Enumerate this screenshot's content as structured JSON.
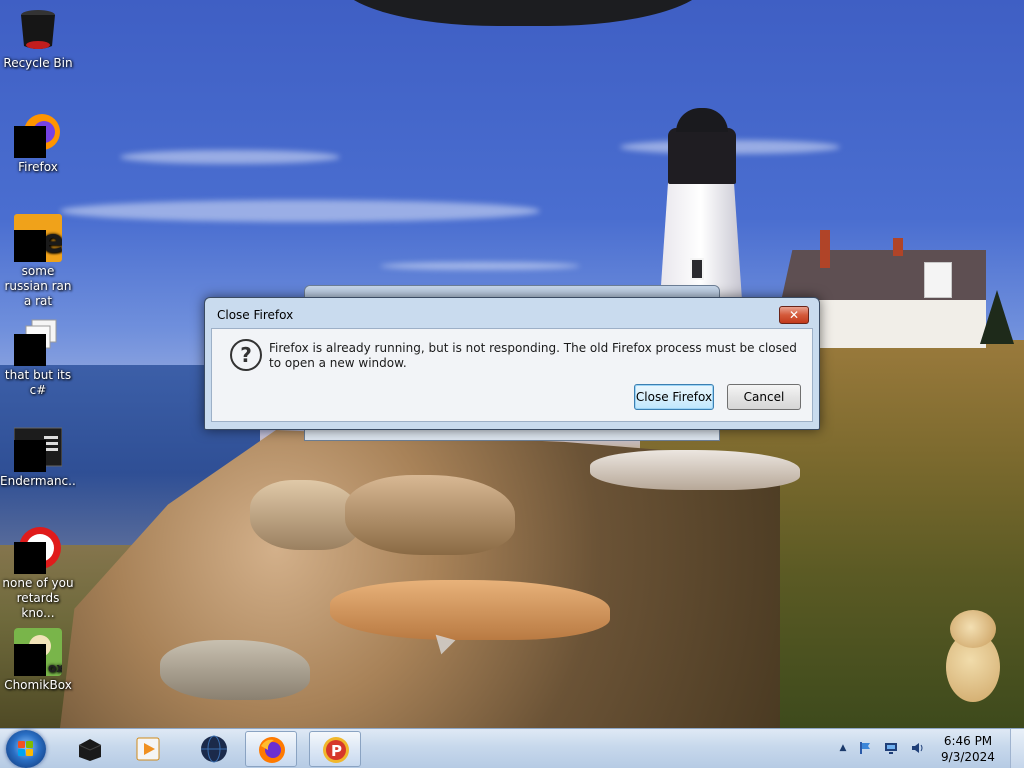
{
  "desktop": {
    "icons": [
      {
        "label": "Recycle Bin",
        "icon": "recycle-bin-icon"
      },
      {
        "label": "Firefox",
        "icon": "firefox-icon"
      },
      {
        "label": "some russian ran a rat",
        "icon": "app-e-icon"
      },
      {
        "label": "that but its c#",
        "icon": "copy-windows-icon"
      },
      {
        "label": "Endermanc...",
        "icon": "app-window-icon"
      },
      {
        "label": "none of you retards kno...",
        "icon": "red-circle-app-icon"
      },
      {
        "label": "ChomikBox",
        "icon": "chomikbox-icon"
      }
    ]
  },
  "dialog": {
    "title": "Close Firefox",
    "close_glyph": "✕",
    "icon": "question-icon",
    "icon_glyph": "?",
    "message": "Firefox is already running, but is not responding. The old Firefox process must be closed to open a new window.",
    "primary_button": "Close Firefox",
    "secondary_button": "Cancel"
  },
  "taskbar": {
    "start_icon": "windows-start-icon",
    "pinned": [
      {
        "name": "black-box-app-icon",
        "active": false
      },
      {
        "name": "media-player-icon",
        "active": false
      },
      {
        "name": "globe-icon",
        "active": false
      },
      {
        "name": "firefox-icon",
        "active": true
      },
      {
        "name": "p-app-icon",
        "active": true
      }
    ],
    "tray": {
      "time": "6:46 PM",
      "date": "9/3/2024",
      "show_hidden_glyph": "▲",
      "icons": [
        "flag-icon",
        "network-icon",
        "speaker-icon"
      ]
    }
  },
  "colors": {
    "dialog_frame": "#c9dbee",
    "taskbar": "#c7d8ec",
    "close_button": "#d45a3a"
  }
}
